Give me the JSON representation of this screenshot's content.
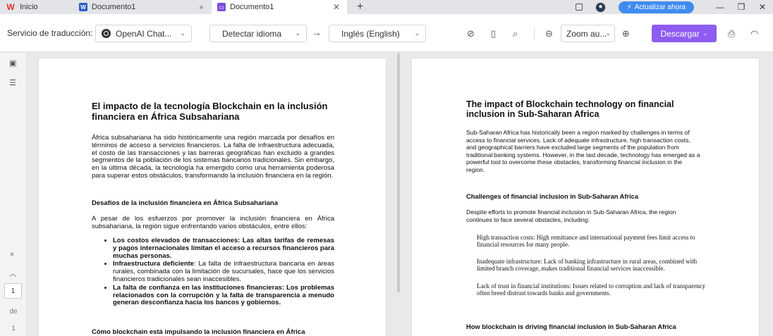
{
  "tabs": [
    {
      "label": "Inicio",
      "icon": "wps-logo-icon"
    },
    {
      "label": "Documento1",
      "icon": "word-doc-icon"
    },
    {
      "label": "Documento1",
      "icon": "pdf-doc-icon",
      "active": true
    }
  ],
  "header": {
    "upgrade_label": "Actualizar ahora"
  },
  "toolbar": {
    "service_label": "Servicio de traducción:",
    "service_value": "OpenAI Chat...",
    "source_lang": "Detectar idioma",
    "target_lang": "Inglés (English)",
    "zoom_value": "Zoom au...",
    "download_label": "Descargar"
  },
  "sidebar": {
    "page_current": "1",
    "page_of": "de",
    "page_total": "1"
  },
  "left_doc": {
    "title": "El impacto de la tecnología Blockchain en la inclusión financiera en África Subsahariana",
    "p1": "África subsahariana ha sido históricamente una región marcada por desafíos en términos de acceso a servicios financieros. La falta de infraestructura adecuada, el costo de las transacciones y las barreras geográficas han excluido a grandes segmentos de la población de los sistemas bancarios tradicionales. Sin embargo, en la última década, la tecnología ha emergido como una herramienta poderosa para superar estos obstáculos, transformando la inclusión financiera en la región.",
    "h1": "Desafíos de la inclusión financiera en África Subsahariana",
    "p2": "A pesar de los esfuerzos por promover la inclusión financiera en África subsahariana, la región sigue enfrentando varios obstáculos, entre ellos:",
    "bullets": [
      {
        "bold": "Los costos elevados de transacciones: Las altas tarifas de remesas y pagos internacionales limitan el acceso a recursos financieros para muchas personas.",
        "rest": ""
      },
      {
        "bold": "Infraestructura deficiente",
        "rest": ": La falta de infraestructura bancaria en áreas rurales, combinada con la limitación de sucursales, hace que los servicios financieros tradicionales sean inaccesibles."
      },
      {
        "bold": "La falta de confianza en las instituciones financieras: Los problemas relacionados con la corrupción y la falta de transparencia a menudo generan desconfianza hacia los bancos y gobiernos.",
        "rest": ""
      }
    ],
    "h2": "Cómo blockchain está impulsando la inclusión financiera en África Subsahariana"
  },
  "right_doc": {
    "title": "The impact of Blockchain technology on financial inclusion in Sub-Saharan Africa",
    "p1": "Sub-Saharan Africa has historically been a region marked by challenges in terms of access to financial services. Lack of adequate infrastructure, high transaction costs, and geographical barriers have excluded large segments of the population from traditional banking systems. However, in the last decade, technology has emerged as a powerful tool to overcome these obstacles, transforming financial inclusion in the region.",
    "h1": "Challenges of financial inclusion in Sub-Saharan Africa",
    "p2": "Despite efforts to promote financial inclusion in Sub-Saharan Africa, the region continues to face several obstacles, including:",
    "b1": "High transaction costs: High remittance and international payment fees limit access to financial resources for many people.",
    "b2": "Inadequate infrastructure: Lack of banking infrastructure in rural areas, combined with limited branch coverage, makes traditional financial services inaccessible.",
    "b3": "Lack of trust in financial institutions: Issues related to corruption and lack of transparency often breed distrust towards banks and governments.",
    "h2": "How blockchain is driving financial inclusion in Sub-Saharan Africa"
  }
}
